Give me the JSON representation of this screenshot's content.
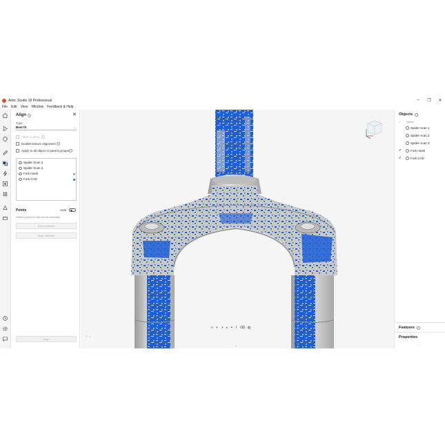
{
  "window": {
    "title": "Artec Studio 18 Professional",
    "controls": [
      "–",
      "❐",
      "✕"
    ]
  },
  "menu": [
    "File",
    "Edit",
    "View",
    "Window",
    "Feedback & Help"
  ],
  "toolbar": {
    "icons": [
      "home-icon",
      "play-icon",
      "scan-icon",
      "pencil-icon",
      "align-icon",
      "bolt-icon",
      "texture-icon",
      "grid-icon",
      "drop-icon",
      "measure-icon",
      "history-icon",
      "settings-icon",
      "chat-icon"
    ]
  },
  "align_panel": {
    "title": "Align",
    "close": "✕",
    "type_label": "Type",
    "type_value": "Best fit",
    "options": [
      {
        "label": "Allow scaling",
        "checked": false,
        "disabled": true
      },
      {
        "label": "Enable texture alignment",
        "checked": false,
        "disabled": false
      },
      {
        "label": "Apply to all object in parent groups",
        "checked": false,
        "disabled": false
      }
    ],
    "objects": [
      {
        "name": "Spider Scan 2",
        "dot": ""
      },
      {
        "name": "Spider Scan 3",
        "dot": ""
      },
      {
        "name": "Fork mesh",
        "dot": "#9e9e9e"
      },
      {
        "name": "Fork CAD",
        "dot": "#2f6bd8"
      }
    ],
    "points_title": "Points",
    "auto_label": "Auto",
    "hint": "Select points on the scene manually",
    "clear_markers": "Clear markers",
    "align_markers": "Align markers",
    "align_button": "Align"
  },
  "viewport": {
    "bottom_icons": [
      "⊹",
      "◐",
      "◑",
      "◒",
      "◓",
      "⌇",
      "⌫",
      "◍"
    ],
    "nav": "◐ ◑",
    "caret": "^"
  },
  "objects_panel": {
    "title": "Objects",
    "name_header": "Name",
    "check_header": "✓",
    "items": [
      {
        "name": "Spider scan 1",
        "checked": false
      },
      {
        "name": "Spider scan 2",
        "checked": false
      },
      {
        "name": "Spider scan 3",
        "checked": false
      },
      {
        "name": "Fork mesh",
        "checked": true
      },
      {
        "name": "Fork CAD",
        "checked": true
      }
    ],
    "features_title": "Features",
    "properties_title": "Properties",
    "caret": "^"
  },
  "colors": {
    "scan_blue": "#1f5fd6",
    "mesh_gray": "#c9c9c9",
    "logo": "#e0502a"
  }
}
